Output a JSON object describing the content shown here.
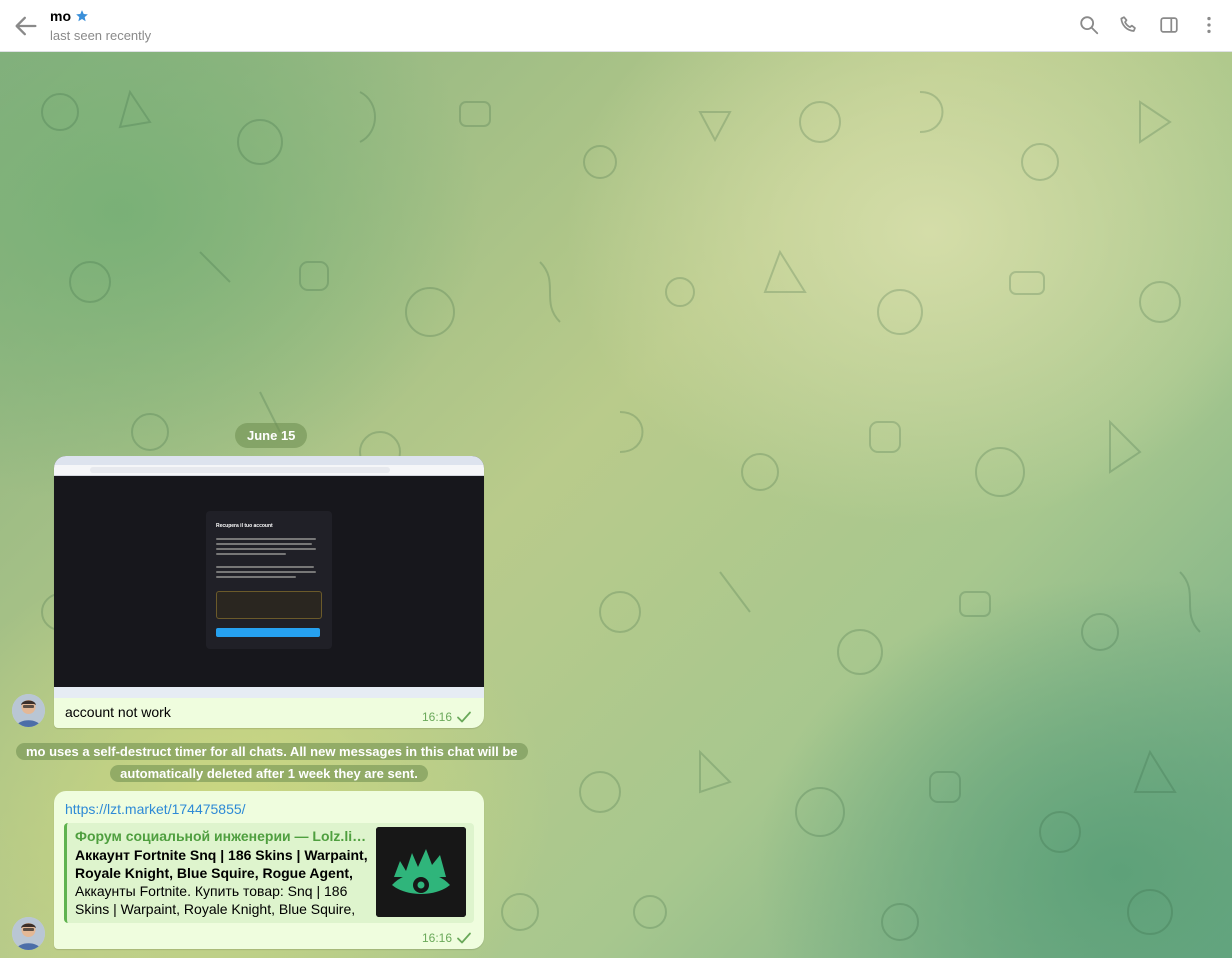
{
  "header": {
    "title": "mo",
    "status": "last seen recently",
    "icons": [
      "back-arrow-icon",
      "star-icon",
      "search-icon",
      "phone-icon",
      "sidebar-toggle-icon",
      "more-vertical-icon"
    ]
  },
  "chat": {
    "date_label": "June 15",
    "messages": [
      {
        "type": "photo",
        "text": "account not work",
        "time": "16:16",
        "status": "sent",
        "screenshot_heading": "Recupera il tuo account"
      },
      {
        "type": "service",
        "text": "mo uses a self-destruct timer for all chats. All new messages in this chat will be automatically deleted after 1 week they are sent."
      },
      {
        "type": "link",
        "url": "https://lzt.market/174475855/",
        "preview_site": "Форум социальной инженерии — Lolz.live...",
        "preview_title": "Аккаунт Fortnite Snq | 186 Skins | Warpaint, Royale Knight, Blue Squire, Rogue Agent, Elite ...",
        "preview_description": "Аккаунты Fortnite. Купить товар: Snq | 186 Skins | Warpaint, Royale Knight, Blue Squire, Ro...",
        "time": "16:16",
        "status": "sent"
      }
    ]
  },
  "colors": {
    "bubble_out": "#effdde",
    "link": "#2e8ad6",
    "preview_accent": "#5fb34f",
    "check": "#6aa95a",
    "service_chip": "#6c8c4e"
  }
}
